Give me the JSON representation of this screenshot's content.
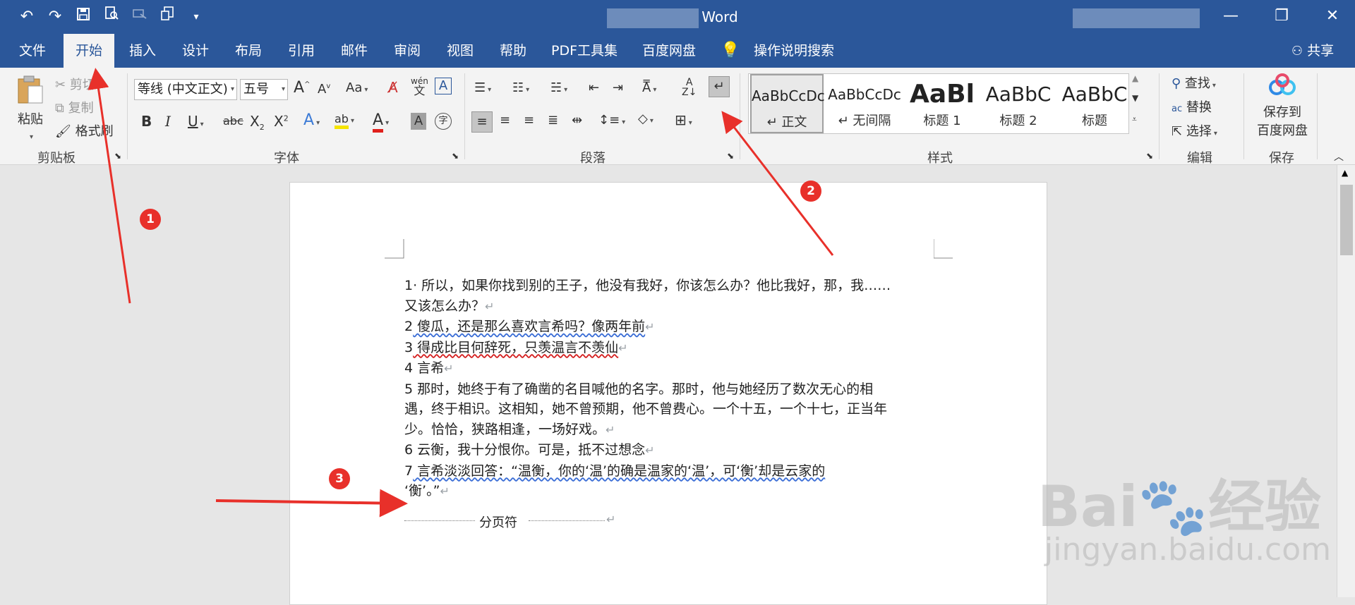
{
  "window": {
    "title": "Word",
    "minimize_glyph": "—",
    "restore_glyph": "❐",
    "close_glyph": "✕"
  },
  "qat": {
    "undo": "undo-icon",
    "redo": "redo-icon",
    "save": "save-icon",
    "print_preview": "print-preview-icon",
    "customize": "▾"
  },
  "tabs": [
    {
      "label": "文件"
    },
    {
      "label": "开始"
    },
    {
      "label": "插入"
    },
    {
      "label": "设计"
    },
    {
      "label": "布局"
    },
    {
      "label": "引用"
    },
    {
      "label": "邮件"
    },
    {
      "label": "审阅"
    },
    {
      "label": "视图"
    },
    {
      "label": "帮助"
    },
    {
      "label": "PDF工具集"
    },
    {
      "label": "百度网盘"
    },
    {
      "label": "操作说明搜索"
    }
  ],
  "share": "共享",
  "clipboard": {
    "paste": "粘贴",
    "cut": "剪切",
    "copy": "复制",
    "format_painter": "格式刷",
    "label": "剪贴板"
  },
  "font": {
    "name": "等线 (中文正文)",
    "size": "五号",
    "grow": "A",
    "shrink": "A",
    "change_case": "Aa",
    "bold": "B",
    "italic": "I",
    "underline": "U",
    "strikethrough": "abc",
    "subscript": "X",
    "superscript": "X",
    "phonetic": "wén",
    "phonetic_char": "文",
    "border_char": "A",
    "font_color": "A",
    "char_shading": "A",
    "enclose": "字",
    "label": "字体"
  },
  "paragraph": {
    "label": "段落"
  },
  "styles": {
    "items": [
      {
        "sample": "AaBbCcDc",
        "name": "↵ 正文"
      },
      {
        "sample": "AaBbCcDc",
        "name": "↵ 无间隔"
      },
      {
        "sample": "AaBl",
        "name": "标题 1"
      },
      {
        "sample": "AaBbC",
        "name": "标题 2"
      },
      {
        "sample": "AaBbC",
        "name": "标题"
      }
    ],
    "label": "样式"
  },
  "editing": {
    "find": "查找",
    "replace": "替换",
    "select": "选择",
    "label": "编辑"
  },
  "save_group": {
    "button": "保存到",
    "button_line2": "百度网盘",
    "label": "保存"
  },
  "document": {
    "lines": [
      {
        "num": "1",
        "text": "· 所以，如果你找到别的王子，他没有我好，你该怎么办？他比我好，那，我……"
      },
      {
        "num": "",
        "text": "又该怎么办？"
      },
      {
        "num": "2",
        "text": " 傻瓜，还是那么喜欢言希吗？像两年前"
      },
      {
        "num": "3",
        "text": " 得成比目何辞死，只羡温言不羡仙"
      },
      {
        "num": "4",
        "text": " 言希"
      },
      {
        "num": "5",
        "text": " 那时，她终于有了确凿的名目喊他的名字。那时，他与她经历了数次无心的相"
      },
      {
        "num": "",
        "text": "遇，终于相识。这相知，她不曾预期，他不曾费心。一个十五，一个十七，正当年"
      },
      {
        "num": "",
        "text": "少。恰恰，狭路相逢，一场好戏。"
      },
      {
        "num": "6",
        "text": " 云衡，我十分恨你。可是，抵不过想念"
      },
      {
        "num": "7",
        "text": " 言希淡淡回答：“温衡，你的‘温’的确是温家的‘温’，可‘衡’却是云家的"
      },
      {
        "num": "",
        "text": "‘衡’。”"
      }
    ],
    "page_break": "分页符",
    "para_mark": "↵"
  },
  "annotations": [
    "1",
    "2",
    "3"
  ],
  "watermark": {
    "brand": "Bai",
    "brand2": "经验",
    "url": "jingyan.baidu.com"
  },
  "colors": {
    "title_bar": "#2b579a",
    "ribbon": "#f3f3f3",
    "annotation": "#e8302a"
  }
}
